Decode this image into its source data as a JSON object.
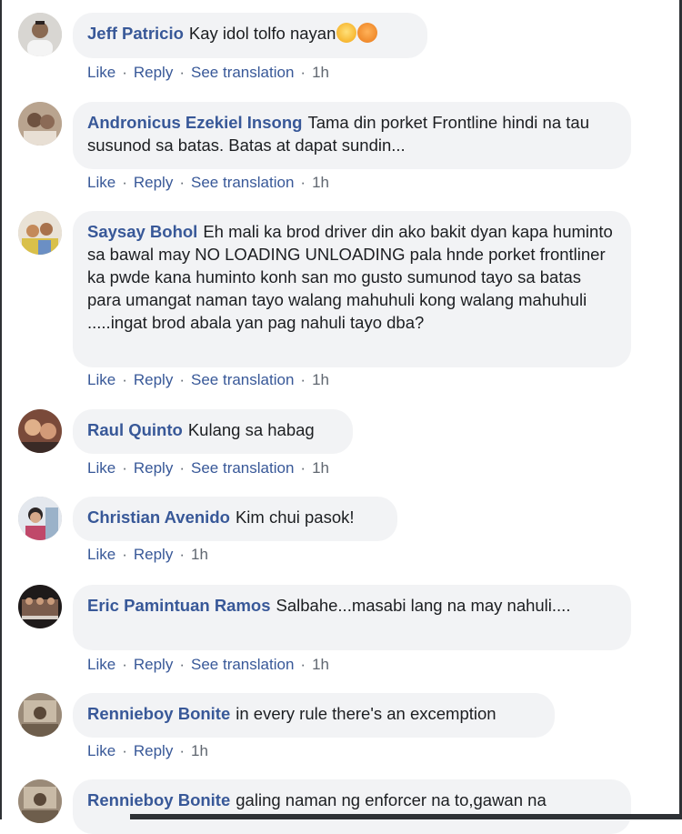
{
  "ui": {
    "like": "Like",
    "reply": "Reply",
    "see_translation": "See translation",
    "separator": "·"
  },
  "colors": {
    "author_link": "#385898",
    "bubble_bg": "#f2f3f5",
    "meta_gray": "#606770"
  },
  "comments": [
    {
      "author": "Jeff Patricio",
      "text": "Kay idol tolfo nayan",
      "emojis": [
        "sweat-face-emoji",
        "angry-face-emoji"
      ],
      "time": "1h",
      "has_translation": true
    },
    {
      "author": "Andronicus Ezekiel Insong",
      "text": "Tama din porket Frontline hindi na tau susunod sa batas. Batas at dapat sundin...",
      "time": "1h",
      "has_translation": true
    },
    {
      "author": "Saysay Bohol",
      "text": "Eh mali ka brod driver din ako bakit dyan kapa huminto sa bawal may NO LOADING UNLOADING pala hnde porket frontliner ka pwde kana huminto konh san mo gusto sumunod tayo sa batas para umangat naman tayo walang mahuhuli kong walang mahuhuli .....ingat brod abala yan pag nahuli tayo dba?",
      "time": "1h",
      "has_translation": true
    },
    {
      "author": "Raul Quinto",
      "text": "Kulang sa habag",
      "time": "1h",
      "has_translation": true
    },
    {
      "author": "Christian Avenido",
      "text": "Kim chui pasok!",
      "time": "1h",
      "has_translation": false
    },
    {
      "author": "Eric Pamintuan Ramos",
      "text": "Salbahe...masabi lang na may nahuli....",
      "time": "1h",
      "has_translation": true
    },
    {
      "author": "Rennieboy Bonite",
      "text": "in every rule there's an excemption",
      "time": "1h",
      "has_translation": false
    },
    {
      "author": "Rennieboy Bonite",
      "text": "galing naman ng enforcer na to,gawan na",
      "time": "",
      "has_translation": false
    }
  ]
}
